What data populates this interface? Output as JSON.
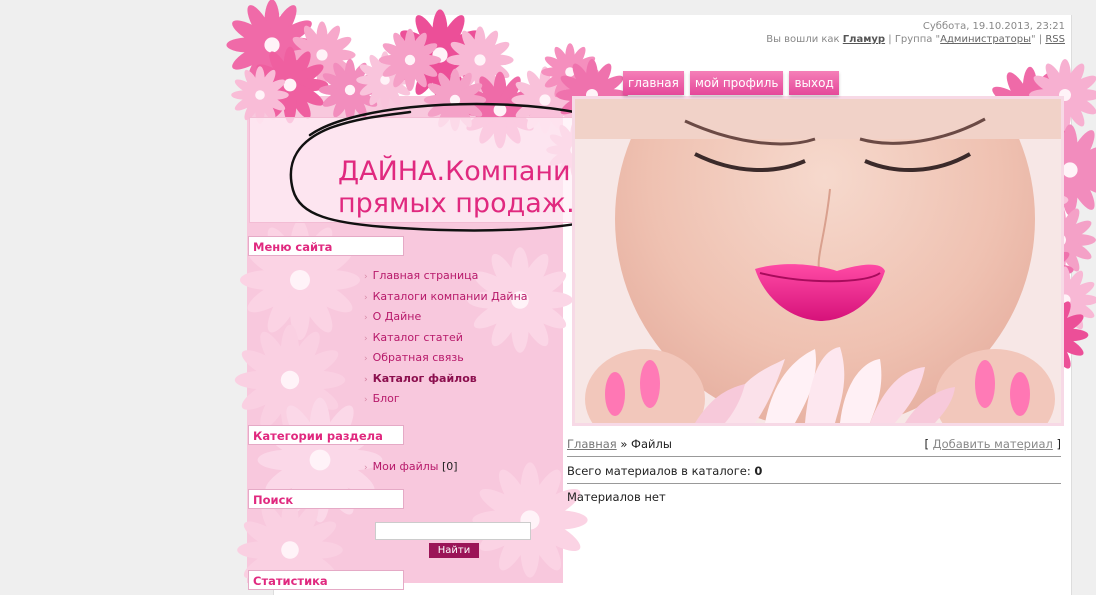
{
  "header": {
    "datetime": "Суббота, 19.10.2013, 23:21",
    "logged_prefix": "Вы вошли как",
    "user": "Гламур",
    "group_prefix": "| Группа \"",
    "group": "Администраторы",
    "group_suffix": "\" |",
    "rss": "RSS"
  },
  "nav": {
    "home": "главная",
    "profile": "мой профиль",
    "logout": "выход"
  },
  "logo": {
    "line1": "ДАЙНА.Компания",
    "line2": "прямых продаж."
  },
  "sidebar": {
    "menu_title": "Меню сайта",
    "menu_items": [
      "Главная страница",
      "Каталоги компании Дайна",
      "О Дайне",
      "Каталог статей",
      "Обратная связь",
      "Каталог файлов",
      "Блог"
    ],
    "categories_title": "Категории раздела",
    "category_item": "Мои файлы",
    "category_count": "[0]",
    "search_title": "Поиск",
    "search_button": "Найти",
    "stats_title": "Статистика"
  },
  "content": {
    "breadcrumb_home": "Главная",
    "breadcrumb_sep": "»",
    "breadcrumb_current": "Файлы",
    "add_open": "[",
    "add_material": "Добавить материал",
    "add_close": "]",
    "total_label": "Всего материалов в каталоге:",
    "total_value": "0",
    "empty_text": "Материалов нет"
  },
  "colors": {
    "accent": "#e0297f",
    "nav_tab": "#e5489a",
    "search_button": "#9b1457"
  }
}
